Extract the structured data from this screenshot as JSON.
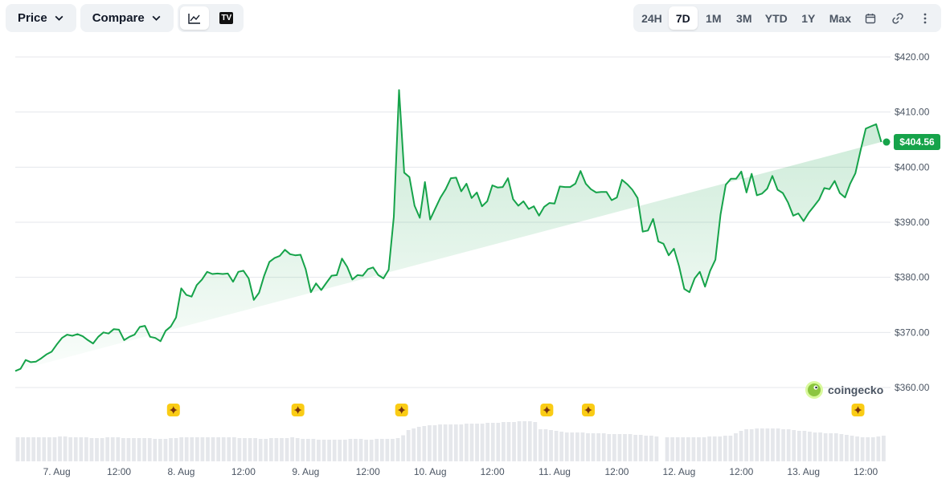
{
  "toolbar": {
    "price_label": "Price",
    "compare_label": "Compare",
    "chart_types": [
      {
        "icon": "line-chart-icon",
        "active": true
      },
      {
        "icon": "tradingview-icon",
        "active": false
      }
    ],
    "tradingview_glyph": "TV",
    "ranges": [
      {
        "label": "24H",
        "active": false
      },
      {
        "label": "7D",
        "active": true
      },
      {
        "label": "1M",
        "active": false
      },
      {
        "label": "3M",
        "active": false
      },
      {
        "label": "YTD",
        "active": false
      },
      {
        "label": "1Y",
        "active": false
      },
      {
        "label": "Max",
        "active": false
      }
    ],
    "icons": [
      "calendar-icon",
      "link-icon",
      "more-vertical-icon"
    ]
  },
  "watermark": "coingecko",
  "colors": {
    "line": "#16a34a",
    "badge": "#16a34a",
    "event": "#facc15",
    "volume": "#e5e7eb"
  },
  "chart_data": {
    "type": "area",
    "x_tick_labels": [
      "7. Aug",
      "12:00",
      "8. Aug",
      "12:00",
      "9. Aug",
      "12:00",
      "10. Aug",
      "12:00",
      "11. Aug",
      "12:00",
      "12. Aug",
      "12:00",
      "13. Aug",
      "12:00"
    ],
    "y_tick_labels": [
      "$360.00",
      "$370.00",
      "$380.00",
      "$390.00",
      "$400.00",
      "$410.00",
      "$420.00"
    ],
    "y_ticks": [
      360,
      370,
      380,
      390,
      400,
      410,
      420
    ],
    "ylim": [
      358,
      420
    ],
    "xlim": [
      0,
      168
    ],
    "grid": true,
    "current_value_label": "$404.56",
    "current_value": 404.56,
    "x": [
      0,
      1,
      2,
      3,
      4,
      5,
      6,
      7,
      8,
      9,
      10,
      11,
      12,
      13,
      14,
      15,
      16,
      17,
      18,
      19,
      20,
      21,
      22,
      23,
      24,
      25,
      26,
      27,
      28,
      29,
      30,
      31,
      32,
      33,
      34,
      35,
      36,
      37,
      38,
      39,
      40,
      41,
      42,
      43,
      44,
      45,
      46,
      47,
      48,
      49,
      50,
      51,
      52,
      53,
      54,
      55,
      56,
      57,
      58,
      59,
      60,
      61,
      62,
      63,
      64,
      65,
      66,
      67,
      68,
      69,
      70,
      71,
      72,
      73,
      74,
      75,
      76,
      77,
      78,
      78.5,
      79,
      80,
      81,
      82,
      83,
      84,
      85,
      86,
      87,
      88,
      89,
      90,
      91,
      92,
      93,
      94,
      95,
      96,
      97,
      98,
      99,
      100,
      101,
      102,
      103,
      104,
      105,
      106,
      107,
      108,
      109,
      110,
      111,
      112,
      113,
      114,
      115,
      116,
      117,
      118,
      119,
      120,
      121,
      122,
      123,
      124,
      125,
      126,
      127,
      128,
      129,
      130,
      131,
      132,
      133,
      134,
      135,
      136,
      137,
      138,
      139,
      140,
      141,
      142,
      143,
      144,
      145,
      146,
      147,
      148,
      149,
      150,
      151,
      152,
      153,
      154,
      155,
      156,
      157,
      158,
      159,
      160,
      161,
      162,
      163,
      164,
      165,
      166,
      167,
      168
    ],
    "series": [
      {
        "values": [
          363.0,
          363.4,
          365.0,
          364.6,
          364.7,
          365.3,
          366.0,
          366.5,
          367.8,
          369.0,
          369.6,
          369.4,
          369.7,
          369.3,
          368.6,
          368.0,
          369.2,
          370.0,
          369.8,
          370.6,
          370.5,
          368.6,
          369.2,
          369.6,
          371.0,
          371.2,
          369.2,
          369.0,
          368.4,
          370.3,
          371.1,
          372.7,
          378.0,
          376.8,
          376.5,
          378.6,
          379.6,
          381.0,
          380.6,
          380.7,
          380.6,
          380.7,
          379.2,
          381.0,
          381.2,
          379.8,
          375.9,
          377.2,
          380.3,
          382.8,
          383.5,
          383.9,
          385.0,
          384.2,
          384.0,
          384.1,
          381.5,
          377.3,
          378.9,
          377.7,
          379.0,
          380.3,
          380.4,
          383.4,
          381.9,
          379.6,
          380.4,
          380.3,
          381.5,
          381.8,
          380.4,
          379.8,
          381.4,
          391.0,
          414.0,
          399.0,
          398.2,
          393.0,
          390.8,
          394.0,
          397.3,
          390.5,
          392.5,
          394.5,
          396.0,
          398.0,
          398.1,
          395.6,
          397.0,
          394.4,
          395.4,
          392.9,
          393.8,
          396.7,
          396.3,
          396.4,
          398.0,
          394.2,
          393.0,
          393.8,
          392.4,
          392.9,
          391.2,
          392.8,
          393.5,
          393.4,
          396.5,
          396.4,
          396.4,
          397.0,
          399.3,
          397.0,
          396.0,
          395.4,
          395.5,
          395.5,
          394.0,
          394.5,
          397.7,
          396.9,
          395.9,
          394.4,
          388.3,
          388.5,
          390.6,
          386.5,
          386.1,
          384.0,
          385.2,
          382.0,
          377.9,
          377.3,
          379.8,
          381.0,
          378.3,
          381.2,
          383.2,
          391.4,
          396.8,
          397.9,
          397.9,
          399.2,
          395.4,
          398.8,
          394.9,
          395.2,
          396.1,
          398.4,
          395.9,
          395.3,
          393.6,
          391.2,
          391.6,
          390.2,
          391.7,
          392.9,
          394.1,
          396.2,
          396.0,
          397.5,
          395.3,
          394.5,
          397.0,
          398.9,
          403.0,
          407.0,
          407.4,
          407.8,
          404.56
        ]
      }
    ],
    "volume_relative": [
      0.6,
      0.6,
      0.6,
      0.6,
      0.6,
      0.6,
      0.6,
      0.6,
      0.62,
      0.62,
      0.6,
      0.6,
      0.6,
      0.6,
      0.58,
      0.58,
      0.58,
      0.6,
      0.6,
      0.6,
      0.58,
      0.58,
      0.58,
      0.58,
      0.58,
      0.58,
      0.56,
      0.56,
      0.56,
      0.58,
      0.58,
      0.6,
      0.6,
      0.6,
      0.6,
      0.6,
      0.6,
      0.6,
      0.6,
      0.6,
      0.6,
      0.6,
      0.58,
      0.58,
      0.58,
      0.58,
      0.56,
      0.56,
      0.58,
      0.58,
      0.58,
      0.58,
      0.6,
      0.58,
      0.56,
      0.56,
      0.56,
      0.54,
      0.54,
      0.54,
      0.54,
      0.54,
      0.54,
      0.56,
      0.56,
      0.56,
      0.54,
      0.54,
      0.56,
      0.56,
      0.56,
      0.56,
      0.58,
      0.65,
      0.78,
      0.82,
      0.86,
      0.88,
      0.9,
      0.9,
      0.92,
      0.92,
      0.92,
      0.92,
      0.92,
      0.94,
      0.94,
      0.94,
      0.94,
      0.96,
      0.96,
      0.96,
      0.98,
      0.98,
      0.98,
      1.0,
      1.0,
      1.0,
      0.98,
      0.8,
      0.8,
      0.78,
      0.76,
      0.74,
      0.72,
      0.72,
      0.72,
      0.72,
      0.7,
      0.7,
      0.7,
      0.7,
      0.68,
      0.68,
      0.68,
      0.68,
      0.68,
      0.66,
      0.66,
      0.64,
      0.64,
      0.62,
      0.0,
      0.6,
      0.6,
      0.6,
      0.6,
      0.6,
      0.6,
      0.6,
      0.6,
      0.62,
      0.62,
      0.62,
      0.64,
      0.64,
      0.7,
      0.76,
      0.8,
      0.8,
      0.82,
      0.82,
      0.82,
      0.82,
      0.82,
      0.8,
      0.8,
      0.78,
      0.76,
      0.76,
      0.74,
      0.72,
      0.72,
      0.7,
      0.7,
      0.7,
      0.68,
      0.66,
      0.64,
      0.62,
      0.6,
      0.6,
      0.6,
      0.62,
      0.64
    ],
    "event_markers_x": [
      30.5,
      54.5,
      74.5,
      102.5,
      110.5,
      162.5
    ]
  }
}
